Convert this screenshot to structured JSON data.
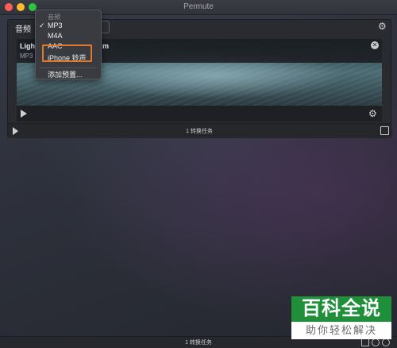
{
  "window": {
    "title": "Permute"
  },
  "panel": {
    "tab_label": "音频",
    "file": {
      "name_part1": "Ligh",
      "name_part2": "m",
      "format": "MP3"
    },
    "task_count": "1 转换任务"
  },
  "format_menu": {
    "header": "音频",
    "items": [
      {
        "label": "MP3",
        "checked": true
      },
      {
        "label": "M4A",
        "checked": false
      },
      {
        "label": "AAC",
        "checked": false
      },
      {
        "label": "iPhone 铃声",
        "checked": false
      }
    ],
    "add_preset": "添加预置...",
    "check_mark": "✓"
  },
  "bottom_bar": {
    "task_count": "1 转换任务"
  },
  "watermark": {
    "top": "百科全说",
    "bottom": "助你轻松解决"
  },
  "colors": {
    "highlight_border": "#e07a2a",
    "watermark_green": "#1f8f3a"
  }
}
